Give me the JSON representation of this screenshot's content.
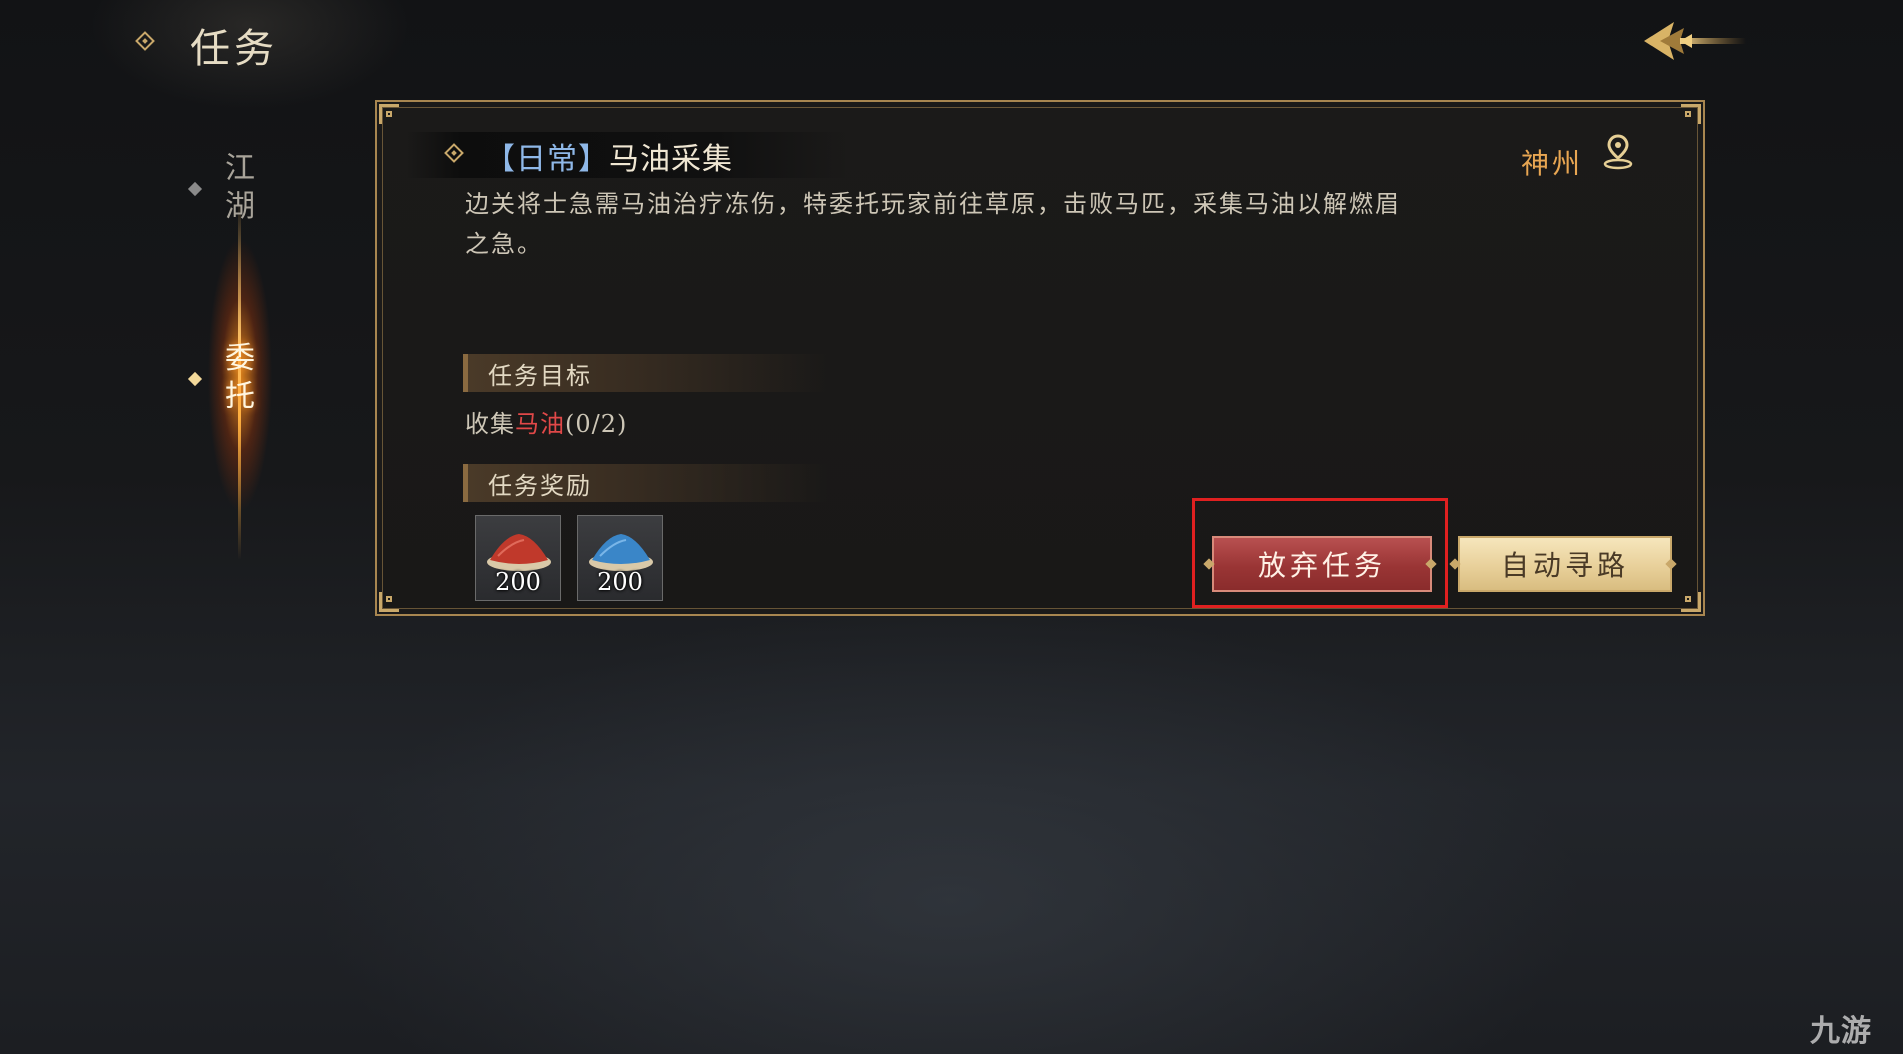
{
  "header": {
    "title": "任务"
  },
  "sidebar": {
    "items": [
      {
        "label": "江湖",
        "active": false
      },
      {
        "label": "委托",
        "active": true
      }
    ]
  },
  "quest": {
    "tag": "【日常】",
    "name": "马油采集",
    "location": "神州",
    "description": "边关将士急需马油治疗冻伤，特委托玩家前往草原，击败马匹，采集马油以解燃眉之急。",
    "objective_section": "任务目标",
    "objective_prefix": "收集",
    "objective_item": "马油",
    "objective_progress": "(0/2)",
    "reward_section": "任务奖励",
    "rewards": [
      {
        "icon": "red-powder-icon",
        "count": "200",
        "color": "#c0392b"
      },
      {
        "icon": "blue-powder-icon",
        "count": "200",
        "color": "#3a86c8"
      }
    ]
  },
  "actions": {
    "abandon": "放弃任务",
    "auto_path": "自动寻路"
  },
  "watermark": "九游",
  "colors": {
    "accent_gold": "#c9a86a",
    "location": "#e8a652",
    "objective_item": "#e04848",
    "highlight": "#e02020"
  }
}
